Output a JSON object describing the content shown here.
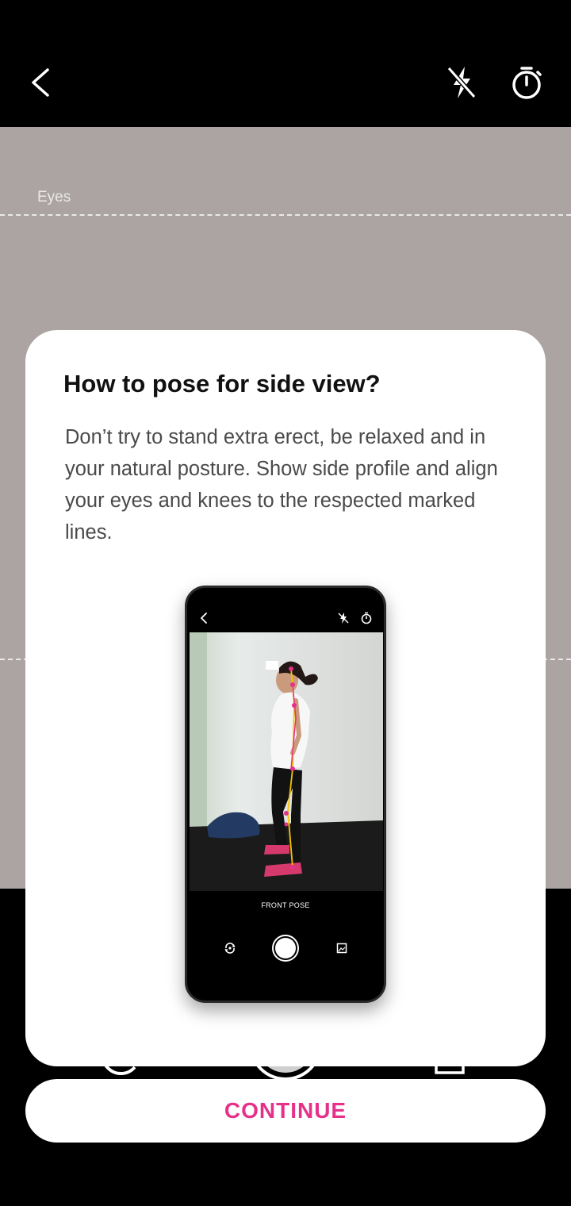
{
  "camera": {
    "eyes_label": "Eyes"
  },
  "dialog": {
    "title": "How to pose for side view?",
    "body": "Don’t try to stand extra erect, be relaxed and in your natural posture. Show side profile and align your eyes and knees to the respected marked lines.",
    "illustration": {
      "pose_label": "FRONT POSE"
    }
  },
  "actions": {
    "continue_label": "CONTINUE"
  },
  "icons": {
    "back": "back-arrow-icon",
    "flash": "flash-off-icon",
    "timer": "timer-icon",
    "flip": "flip-camera-icon",
    "shutter": "shutter-icon",
    "gallery": "gallery-icon"
  },
  "colors": {
    "accent": "#e6318a",
    "camera_bg": "#aba4a3",
    "pose_joint": "#e6318a",
    "pose_line": "#f5c400"
  }
}
